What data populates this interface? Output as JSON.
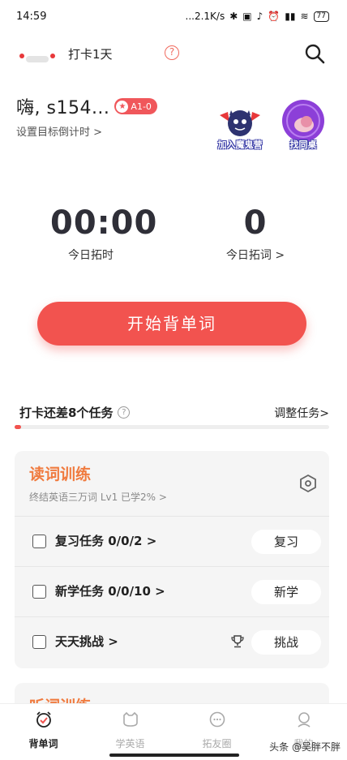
{
  "status": {
    "time": "14:59",
    "net_speed": "...2.1K/s",
    "battery": "77"
  },
  "header": {
    "checkin_days": "打卡1天",
    "help_icon": "help-circle-icon",
    "search_icon": "search-icon"
  },
  "greeting": {
    "text": "嗨, s154...",
    "level": "A1-0",
    "goal_link": "设置目标倒计时 >"
  },
  "mascots": [
    {
      "label": "加入魔鬼营",
      "icon": "demon-mascot-icon"
    },
    {
      "label": "找同桌",
      "icon": "snail-mascot-icon"
    }
  ],
  "stats": {
    "time_value": "00:00",
    "time_label": "今日拓时",
    "words_value": "0",
    "words_label": "今日拓词 >"
  },
  "start_button": "开始背单词",
  "tasks": {
    "remaining": "打卡还差8个任务",
    "adjust": "调整任务>",
    "progress": 0.01
  },
  "reading_card": {
    "title": "读词训练",
    "subtitle": "终结英语三万词 Lv1   已学2% >",
    "rows": [
      {
        "label": "复习任务 0/0/2  >",
        "button": "复习"
      },
      {
        "label": "新学任务 0/0/10  >",
        "button": "新学"
      },
      {
        "label": "天天挑战  >",
        "button": "挑战"
      }
    ]
  },
  "listening_card": {
    "title": "听词训练"
  },
  "tabs": [
    {
      "label": "背单词",
      "active": true
    },
    {
      "label": "学英语",
      "active": false
    },
    {
      "label": "拓友圈",
      "active": false
    },
    {
      "label": "我的",
      "active": false
    }
  ],
  "watermark": "头条 @吴胖不胖",
  "colors": {
    "accent": "#f2534f",
    "card_title": "#f07b3f"
  }
}
